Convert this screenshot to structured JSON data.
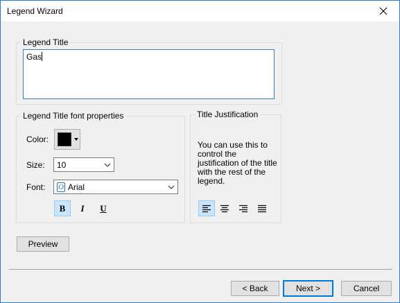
{
  "window": {
    "title": "Legend Wizard"
  },
  "legend_title": {
    "group_label": "Legend Title",
    "value": "Gas"
  },
  "font_props": {
    "group_label": "Legend Title font properties",
    "color_label": "Color:",
    "color_value": "#000000",
    "size_label": "Size:",
    "size_value": "10",
    "font_label": "Font:",
    "font_value": "Arial",
    "bold": "B",
    "italic": "I",
    "underline": "U"
  },
  "justification": {
    "group_label": "Title Justification",
    "description": "You can use this to control the justification of the title with the rest of the legend.",
    "selected": "left"
  },
  "buttons": {
    "preview": "Preview",
    "back": "< Back",
    "next": "Next >",
    "cancel": "Cancel"
  },
  "colors": {
    "accent": "#0078d7",
    "selected_bg": "#cce4f7",
    "window_bg": "#f0f0f0"
  }
}
